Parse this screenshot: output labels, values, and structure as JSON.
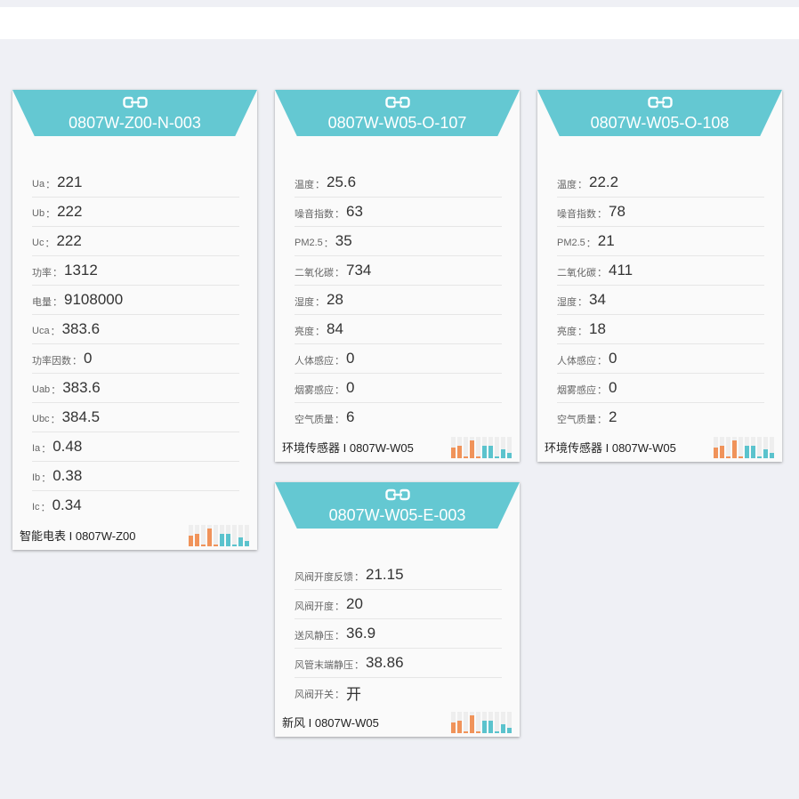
{
  "cards": [
    {
      "title": "0807W-Z00-N-003",
      "rows": [
        {
          "label": "Ua",
          "value": "221"
        },
        {
          "label": "Ub",
          "value": "222"
        },
        {
          "label": "Uc",
          "value": "222"
        },
        {
          "label": "功率",
          "value": "1312"
        },
        {
          "label": "电量",
          "value": "9108000"
        },
        {
          "label": "Uca",
          "value": "383.6"
        },
        {
          "label": "功率因数",
          "value": "0"
        },
        {
          "label": "Uab",
          "value": "383.6"
        },
        {
          "label": "Ubc",
          "value": "384.5"
        },
        {
          "label": "Ia",
          "value": "0.48"
        },
        {
          "label": "Ib",
          "value": "0.38"
        },
        {
          "label": "Ic",
          "value": "0.34"
        }
      ],
      "footer": "智能电表 I 0807W-Z00"
    },
    {
      "title": "0807W-W05-O-107",
      "rows": [
        {
          "label": "温度",
          "value": "25.6"
        },
        {
          "label": "噪音指数",
          "value": "63"
        },
        {
          "label": "PM2.5",
          "value": "35"
        },
        {
          "label": "二氧化碳",
          "value": "734"
        },
        {
          "label": "湿度",
          "value": "28"
        },
        {
          "label": "亮度",
          "value": "84"
        },
        {
          "label": "人体感应",
          "value": "0"
        },
        {
          "label": "烟雾感应",
          "value": "0"
        },
        {
          "label": "空气质量",
          "value": "6"
        }
      ],
      "footer": "环境传感器 I 0807W-W05"
    },
    {
      "title": "0807W-W05-O-108",
      "rows": [
        {
          "label": "温度",
          "value": "22.2"
        },
        {
          "label": "噪音指数",
          "value": "78"
        },
        {
          "label": "PM2.5",
          "value": "21"
        },
        {
          "label": "二氧化碳",
          "value": "411"
        },
        {
          "label": "湿度",
          "value": "34"
        },
        {
          "label": "亮度",
          "value": "18"
        },
        {
          "label": "人体感应",
          "value": "0"
        },
        {
          "label": "烟雾感应",
          "value": "0"
        },
        {
          "label": "空气质量",
          "value": "2"
        }
      ],
      "footer": "环境传感器 I 0807W-W05"
    },
    {
      "title": "0807W-W05-E-003",
      "rows": [
        {
          "label": "风阀开度反馈",
          "value": "21.15"
        },
        {
          "label": "风阀开度",
          "value": "20"
        },
        {
          "label": "送风静压",
          "value": "36.9"
        },
        {
          "label": "风管末端静压",
          "value": "38.86"
        },
        {
          "label": "风阀开关",
          "value": "开"
        }
      ],
      "footer": "新风 I 0807W-W05"
    }
  ],
  "colon": "：",
  "colors": {
    "header": "#64c8d2",
    "bar_orange": "#f0935a",
    "bar_teal": "#5bc3cd",
    "bar_bg": "#eeeeee"
  },
  "icons": {
    "header": "link-icon",
    "footer": "bar-chart-icon"
  }
}
